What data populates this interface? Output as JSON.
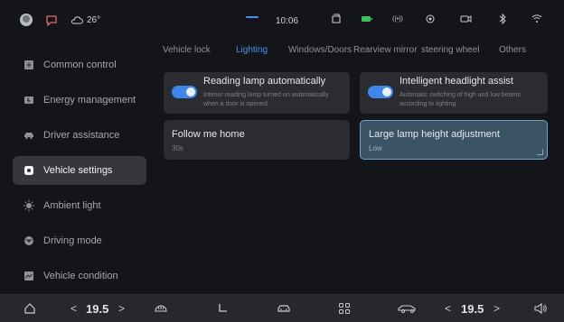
{
  "status": {
    "weather_temp": "26°",
    "time": "10:06"
  },
  "sidebar": {
    "items": [
      {
        "label": "Common control",
        "icon": "grid-icon",
        "active": false
      },
      {
        "label": "Energy management",
        "icon": "battery-icon",
        "active": false
      },
      {
        "label": "Driver assistance",
        "icon": "car-assist-icon",
        "active": false
      },
      {
        "label": "Vehicle settings",
        "icon": "settings-icon",
        "active": true
      },
      {
        "label": "Ambient light",
        "icon": "sun-icon",
        "active": false
      },
      {
        "label": "Driving mode",
        "icon": "steering-icon",
        "active": false
      },
      {
        "label": "Vehicle condition",
        "icon": "chart-icon",
        "active": false
      }
    ]
  },
  "tabs": [
    {
      "label": "Vehicle lock",
      "active": false
    },
    {
      "label": "Lighting",
      "active": true
    },
    {
      "label": "Windows/Doors",
      "active": false
    },
    {
      "label": "Rearview mirror",
      "active": false
    },
    {
      "label": "steering wheel",
      "active": false
    },
    {
      "label": "Others",
      "active": false
    }
  ],
  "cards": {
    "reading_lamp": {
      "title": "Reading lamp automatically",
      "desc": "Interior reading lamp turned on automatically when a door is opened",
      "enabled": true
    },
    "headlight_assist": {
      "title": "Intelligent headlight assist",
      "desc": "Automatic switching of high and low beams according to lighting",
      "enabled": true
    },
    "follow_me_home": {
      "title": "Follow me home",
      "value": "30s"
    },
    "lamp_height": {
      "title": "Large lamp height adjustment",
      "value": "Low"
    }
  },
  "dock": {
    "left_temp": "19.5",
    "right_temp": "19.5"
  },
  "colors": {
    "accent": "#4a8ff1",
    "background": "#141518",
    "card": "#2a2c31",
    "selected_card": "#3a5466"
  }
}
